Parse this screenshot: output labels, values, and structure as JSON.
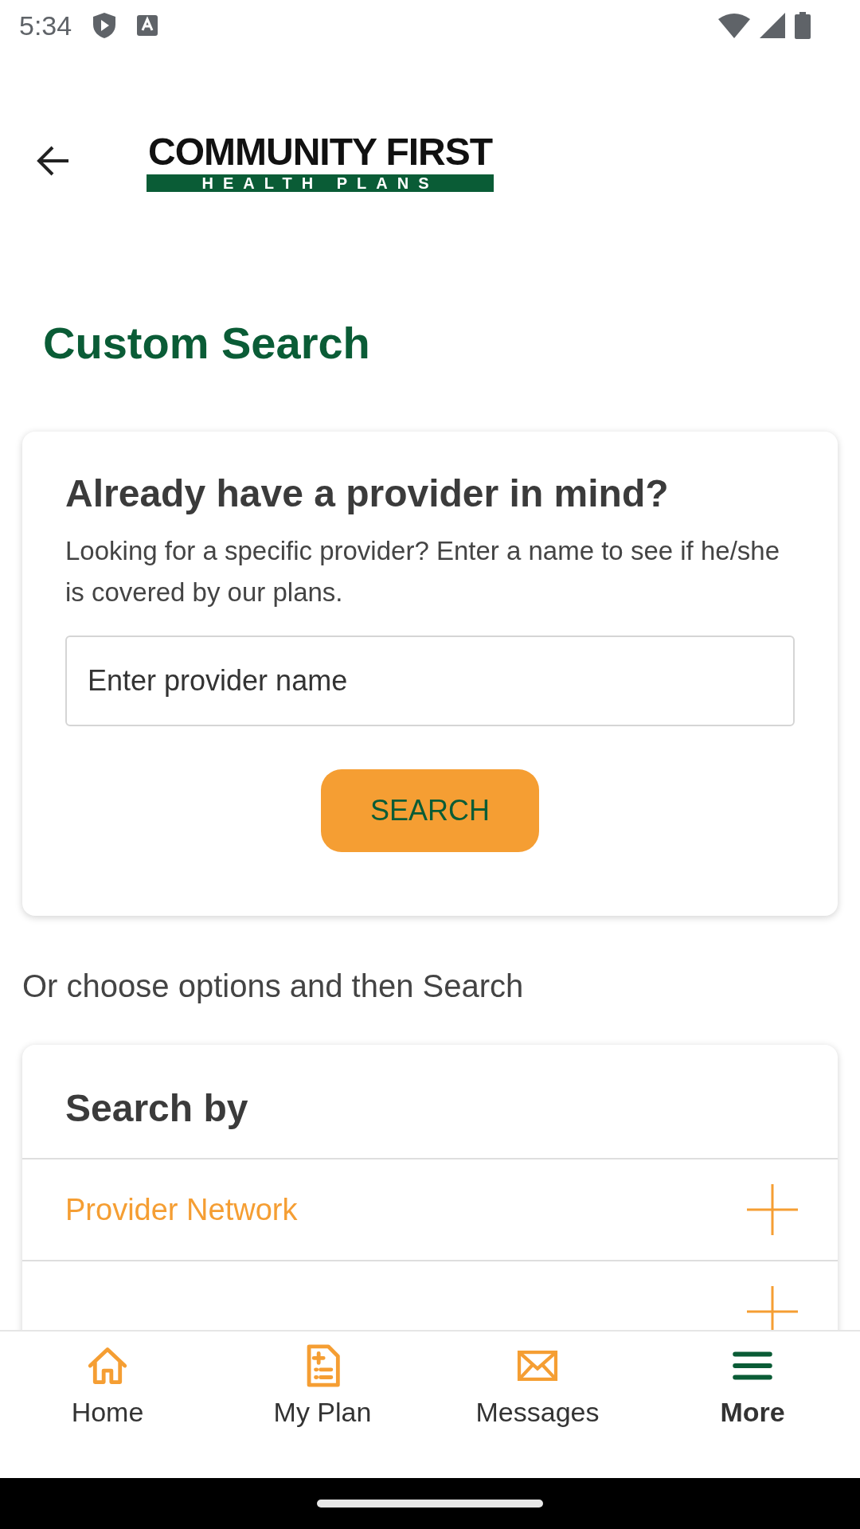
{
  "status_bar": {
    "time": "5:34"
  },
  "header": {
    "logo": {
      "line1": "COMMUNITY FIRST",
      "line2": "HEALTH PLANS"
    }
  },
  "title": "Custom Search",
  "provider_card": {
    "heading": "Already have a provider in mind?",
    "description": "Looking for a specific provider? Enter a name to see if he/she is covered by our plans.",
    "search_field": {
      "placeholder": "Enter provider name"
    },
    "button": "SEARCH"
  },
  "options_hint": "Or choose options and then Search",
  "search_by": {
    "heading": "Search by",
    "rows": [
      {
        "label": "Provider Network",
        "expanded": false
      },
      {
        "expanded": false
      }
    ]
  },
  "bottom_nav": [
    {
      "label": "Home",
      "selected": false
    },
    {
      "label": "My Plan",
      "selected": false
    },
    {
      "label": "Messages",
      "selected": false
    },
    {
      "label": "More",
      "selected": true
    }
  ]
}
